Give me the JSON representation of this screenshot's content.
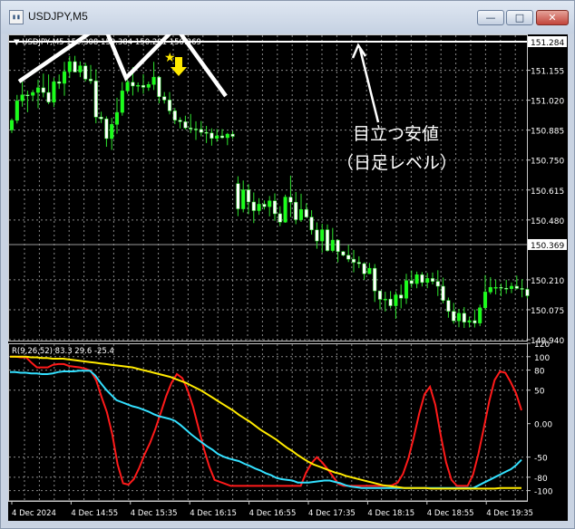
{
  "window": {
    "title": "USDJPY,M5",
    "buttons": {
      "minimize": "—",
      "maximize": "□",
      "close": "✕"
    },
    "icon": "chart-window-icon"
  },
  "chart_data": [
    {
      "type": "candlestick",
      "header": "▼ USDJPY,M5 150.308 150.384 150.291 150.369",
      "price_labels": [
        "151.284",
        "151.155",
        "151.020",
        "150.885",
        "150.750",
        "150.615",
        "150.480",
        "150.369",
        "150.210",
        "150.075",
        "149.940"
      ],
      "ylim": [
        149.94,
        151.284
      ],
      "horizontal_line": {
        "value": 151.284,
        "label": "151.284",
        "color": "#ffffff"
      },
      "current_price": {
        "value": 150.369,
        "label": "150.369"
      },
      "bull_color": "#19ff19",
      "bear_color": "#ffffff",
      "candles": [
        {
          "o": 150.886,
          "h": 150.938,
          "l": 150.872,
          "c": 150.929
        },
        {
          "o": 150.929,
          "h": 151.044,
          "l": 150.915,
          "c": 151.017
        },
        {
          "o": 151.017,
          "h": 151.103,
          "l": 150.991,
          "c": 151.044
        },
        {
          "o": 151.044,
          "h": 151.063,
          "l": 150.966,
          "c": 151.042
        },
        {
          "o": 151.042,
          "h": 151.066,
          "l": 151.016,
          "c": 151.055
        },
        {
          "o": 151.055,
          "h": 151.113,
          "l": 150.984,
          "c": 151.076
        },
        {
          "o": 151.076,
          "h": 151.14,
          "l": 151.033,
          "c": 151.055
        },
        {
          "o": 151.055,
          "h": 151.136,
          "l": 151.002,
          "c": 151.011
        },
        {
          "o": 151.011,
          "h": 151.122,
          "l": 150.989,
          "c": 151.103
        },
        {
          "o": 151.103,
          "h": 151.136,
          "l": 151.071,
          "c": 151.096
        },
        {
          "o": 151.096,
          "h": 151.193,
          "l": 151.04,
          "c": 151.149
        },
        {
          "o": 151.149,
          "h": 151.219,
          "l": 151.12,
          "c": 151.194
        },
        {
          "o": 151.194,
          "h": 151.22,
          "l": 151.148,
          "c": 151.147
        },
        {
          "o": 151.147,
          "h": 151.195,
          "l": 151.124,
          "c": 151.175
        },
        {
          "o": 151.175,
          "h": 151.189,
          "l": 151.104,
          "c": 151.115
        },
        {
          "o": 151.115,
          "h": 151.179,
          "l": 151.094,
          "c": 151.107
        },
        {
          "o": 151.107,
          "h": 151.159,
          "l": 150.916,
          "c": 150.944
        },
        {
          "o": 150.944,
          "h": 150.968,
          "l": 150.917,
          "c": 150.936
        },
        {
          "o": 150.936,
          "h": 150.947,
          "l": 150.81,
          "c": 150.847
        },
        {
          "o": 150.847,
          "h": 150.941,
          "l": 150.796,
          "c": 150.911
        },
        {
          "o": 150.911,
          "h": 151.031,
          "l": 150.869,
          "c": 150.965
        },
        {
          "o": 150.965,
          "h": 151.102,
          "l": 150.95,
          "c": 151.062
        },
        {
          "o": 151.062,
          "h": 151.115,
          "l": 151.049,
          "c": 151.101
        },
        {
          "o": 151.101,
          "h": 151.169,
          "l": 151.041,
          "c": 151.084
        },
        {
          "o": 151.084,
          "h": 151.1,
          "l": 151.057,
          "c": 151.087
        },
        {
          "o": 151.087,
          "h": 151.137,
          "l": 151.049,
          "c": 151.078
        },
        {
          "o": 151.078,
          "h": 151.104,
          "l": 151.062,
          "c": 151.091
        },
        {
          "o": 151.091,
          "h": 151.193,
          "l": 151.066,
          "c": 151.124
        },
        {
          "o": 151.124,
          "h": 151.13,
          "l": 151.006,
          "c": 151.036
        },
        {
          "o": 151.036,
          "h": 151.057,
          "l": 151.005,
          "c": 151.021
        },
        {
          "o": 151.021,
          "h": 151.057,
          "l": 150.956,
          "c": 150.972
        },
        {
          "o": 150.972,
          "h": 150.985,
          "l": 150.912,
          "c": 150.93
        },
        {
          "o": 150.93,
          "h": 150.943,
          "l": 150.893,
          "c": 150.923
        },
        {
          "o": 150.923,
          "h": 150.95,
          "l": 150.888,
          "c": 150.895
        },
        {
          "o": 150.895,
          "h": 150.958,
          "l": 150.872,
          "c": 150.89
        },
        {
          "o": 150.89,
          "h": 150.925,
          "l": 150.841,
          "c": 150.889
        },
        {
          "o": 150.889,
          "h": 150.926,
          "l": 150.857,
          "c": 150.875
        },
        {
          "o": 150.875,
          "h": 150.904,
          "l": 150.827,
          "c": 150.872
        },
        {
          "o": 150.872,
          "h": 150.893,
          "l": 150.815,
          "c": 150.848
        },
        {
          "o": 150.848,
          "h": 150.89,
          "l": 150.833,
          "c": 150.859
        },
        {
          "o": 150.859,
          "h": 150.89,
          "l": 150.846,
          "c": 150.851
        },
        {
          "o": 150.851,
          "h": 150.873,
          "l": 150.817,
          "c": 150.867
        },
        {
          "o": 150.867,
          "h": 150.88,
          "l": 150.846,
          "c": 150.857
        },
        {
          "o": 150.644,
          "h": 150.677,
          "l": 150.497,
          "c": 150.53
        },
        {
          "o": 150.53,
          "h": 150.658,
          "l": 150.514,
          "c": 150.616
        },
        {
          "o": 150.616,
          "h": 150.641,
          "l": 150.506,
          "c": 150.561
        },
        {
          "o": 150.561,
          "h": 150.604,
          "l": 150.466,
          "c": 150.522
        },
        {
          "o": 150.522,
          "h": 150.578,
          "l": 150.503,
          "c": 150.551
        },
        {
          "o": 150.551,
          "h": 150.568,
          "l": 150.527,
          "c": 150.54
        },
        {
          "o": 150.54,
          "h": 150.588,
          "l": 150.496,
          "c": 150.566
        },
        {
          "o": 150.566,
          "h": 150.6,
          "l": 150.476,
          "c": 150.508
        },
        {
          "o": 150.508,
          "h": 150.542,
          "l": 150.452,
          "c": 150.47
        },
        {
          "o": 150.47,
          "h": 150.594,
          "l": 150.467,
          "c": 150.583
        },
        {
          "o": 150.583,
          "h": 150.68,
          "l": 150.493,
          "c": 150.56
        },
        {
          "o": 150.56,
          "h": 150.606,
          "l": 150.461,
          "c": 150.481
        },
        {
          "o": 150.481,
          "h": 150.598,
          "l": 150.471,
          "c": 150.527
        },
        {
          "o": 150.527,
          "h": 150.555,
          "l": 150.492,
          "c": 150.493
        },
        {
          "o": 150.493,
          "h": 150.524,
          "l": 150.414,
          "c": 150.435
        },
        {
          "o": 150.435,
          "h": 150.469,
          "l": 150.35,
          "c": 150.385
        },
        {
          "o": 150.385,
          "h": 150.463,
          "l": 150.333,
          "c": 150.436
        },
        {
          "o": 150.436,
          "h": 150.46,
          "l": 150.337,
          "c": 150.342
        },
        {
          "o": 150.342,
          "h": 150.444,
          "l": 150.334,
          "c": 150.389
        },
        {
          "o": 150.389,
          "h": 150.393,
          "l": 150.289,
          "c": 150.337
        },
        {
          "o": 150.337,
          "h": 150.34,
          "l": 150.316,
          "c": 150.321
        },
        {
          "o": 150.321,
          "h": 150.367,
          "l": 150.29,
          "c": 150.303
        },
        {
          "o": 150.303,
          "h": 150.345,
          "l": 150.244,
          "c": 150.289
        },
        {
          "o": 150.289,
          "h": 150.316,
          "l": 150.263,
          "c": 150.283
        },
        {
          "o": 150.283,
          "h": 150.289,
          "l": 150.21,
          "c": 150.237
        },
        {
          "o": 150.237,
          "h": 150.286,
          "l": 150.236,
          "c": 150.262
        },
        {
          "o": 150.262,
          "h": 150.281,
          "l": 150.11,
          "c": 150.16
        },
        {
          "o": 150.16,
          "h": 150.159,
          "l": 150.076,
          "c": 150.122
        },
        {
          "o": 150.122,
          "h": 150.156,
          "l": 150.067,
          "c": 150.123
        },
        {
          "o": 150.123,
          "h": 150.159,
          "l": 150.081,
          "c": 150.093
        },
        {
          "o": 150.093,
          "h": 150.158,
          "l": 150.034,
          "c": 150.142
        },
        {
          "o": 150.142,
          "h": 150.189,
          "l": 150.081,
          "c": 150.127
        },
        {
          "o": 150.127,
          "h": 150.237,
          "l": 150.101,
          "c": 150.206
        },
        {
          "o": 150.206,
          "h": 150.252,
          "l": 150.174,
          "c": 150.193
        },
        {
          "o": 150.193,
          "h": 150.247,
          "l": 150.172,
          "c": 150.233
        },
        {
          "o": 150.233,
          "h": 150.245,
          "l": 150.18,
          "c": 150.198
        },
        {
          "o": 150.198,
          "h": 150.241,
          "l": 150.172,
          "c": 150.216
        },
        {
          "o": 150.216,
          "h": 150.243,
          "l": 150.189,
          "c": 150.203
        },
        {
          "o": 150.203,
          "h": 150.253,
          "l": 150.137,
          "c": 150.181
        },
        {
          "o": 150.181,
          "h": 150.22,
          "l": 150.104,
          "c": 150.117
        },
        {
          "o": 150.117,
          "h": 150.13,
          "l": 150.039,
          "c": 150.068
        },
        {
          "o": 150.068,
          "h": 150.106,
          "l": 150.012,
          "c": 150.025
        },
        {
          "o": 150.025,
          "h": 150.079,
          "l": 149.996,
          "c": 150.059
        },
        {
          "o": 150.059,
          "h": 150.087,
          "l": 149.993,
          "c": 150.019
        },
        {
          "o": 150.019,
          "h": 150.044,
          "l": 149.995,
          "c": 150.026
        },
        {
          "o": 150.026,
          "h": 150.076,
          "l": 149.995,
          "c": 150.015
        },
        {
          "o": 150.015,
          "h": 150.098,
          "l": 150.001,
          "c": 150.084
        },
        {
          "o": 150.084,
          "h": 150.231,
          "l": 150.074,
          "c": 150.155
        },
        {
          "o": 150.155,
          "h": 150.222,
          "l": 150.145,
          "c": 150.176
        },
        {
          "o": 150.176,
          "h": 150.211,
          "l": 150.144,
          "c": 150.176
        },
        {
          "o": 150.176,
          "h": 150.193,
          "l": 150.136,
          "c": 150.172
        },
        {
          "o": 150.172,
          "h": 150.21,
          "l": 150.147,
          "c": 150.17
        },
        {
          "o": 150.17,
          "h": 150.198,
          "l": 150.15,
          "c": 150.181
        },
        {
          "o": 150.181,
          "h": 150.229,
          "l": 150.166,
          "c": 150.171
        },
        {
          "o": 150.171,
          "h": 150.213,
          "l": 150.131,
          "c": 150.167
        },
        {
          "o": 150.167,
          "h": 150.174,
          "l": 150.126,
          "c": 150.138
        }
      ],
      "annotation": {
        "line1": "目立つ安値",
        "line2": "（日足レベル）",
        "color": "#ffffff"
      },
      "markers": [
        "star-marker",
        "down-arrow-marker"
      ],
      "marker_color": "#ffea00"
    },
    {
      "type": "line",
      "header": "R(9,26,52) 83.3 29.6 -25.4",
      "ylabels": [
        "120",
        "100",
        "80",
        "50",
        "0.00",
        "-50",
        "-80",
        "-100"
      ],
      "ylim": [
        -110,
        120
      ],
      "ref_lines": [
        100,
        80,
        50,
        -50,
        -80,
        -100
      ],
      "series": [
        {
          "color": "#ff1a1a",
          "values": [
            100,
            100,
            99,
            99,
            91,
            84,
            84,
            84,
            88,
            89,
            89,
            86,
            85,
            84,
            82,
            79,
            65,
            40,
            17,
            -16,
            -61,
            -89,
            -91,
            -83,
            -66,
            -46,
            -29,
            -8,
            16,
            41,
            61,
            74,
            68,
            50,
            25,
            -6,
            -37,
            -64,
            -84,
            -87,
            -90,
            -93,
            -93,
            -93,
            -93,
            -93,
            -93,
            -93,
            -93,
            -93,
            -93,
            -93,
            -93,
            -93,
            -93,
            -73,
            -59,
            -50,
            -58,
            -68,
            -79,
            -90,
            -93,
            -93,
            -93,
            -93,
            -93,
            -93,
            -93,
            -93,
            -93,
            -92,
            -88,
            -75,
            -52,
            -20,
            15,
            44,
            55,
            28,
            -17,
            -58,
            -84,
            -93,
            -93,
            -93,
            -76,
            -45,
            -7,
            33,
            65,
            78,
            76,
            62,
            45,
            20
          ]
        },
        {
          "color": "#33e0ff",
          "values": [
            77,
            77,
            76,
            76,
            75,
            75,
            74,
            74,
            75,
            77,
            78,
            78,
            78,
            79,
            79,
            79,
            72,
            61,
            51,
            43,
            35,
            32,
            29,
            26,
            24,
            21,
            18,
            14,
            11,
            9,
            7,
            4,
            -2,
            -9,
            -16,
            -22,
            -28,
            -34,
            -39,
            -45,
            -49,
            -52,
            -54,
            -56,
            -60,
            -63,
            -67,
            -70,
            -74,
            -77,
            -81,
            -83,
            -84,
            -85,
            -88,
            -88,
            -88,
            -87,
            -86,
            -85,
            -85,
            -87,
            -89,
            -92,
            -94,
            -95,
            -96,
            -96,
            -96,
            -96,
            -96,
            -96,
            -96,
            -96,
            -96,
            -96,
            -96,
            -96,
            -96,
            -96,
            -96,
            -96,
            -96,
            -96,
            -96,
            -96,
            -96,
            -96,
            -92,
            -88,
            -84,
            -80,
            -76,
            -72,
            -68,
            -62,
            -54
          ]
        },
        {
          "color": "#ffea00",
          "values": [
            100,
            100,
            100,
            100,
            99,
            99,
            98,
            98,
            97,
            97,
            97,
            96,
            95,
            94,
            93,
            92,
            91,
            90,
            89,
            88,
            87,
            86,
            85,
            84,
            82,
            80,
            78,
            76,
            74,
            72,
            70,
            67,
            64,
            61,
            57,
            53,
            49,
            44,
            39,
            34,
            29,
            24,
            19,
            13,
            8,
            3,
            -3,
            -9,
            -14,
            -19,
            -24,
            -30,
            -36,
            -41,
            -47,
            -52,
            -57,
            -61,
            -64,
            -67,
            -70,
            -73,
            -75,
            -78,
            -80,
            -82,
            -84,
            -86,
            -88,
            -90,
            -92,
            -93,
            -94,
            -95,
            -96,
            -96,
            -96,
            -96,
            -96,
            -97,
            -97,
            -97,
            -97,
            -97,
            -97,
            -97,
            -97,
            -97,
            -97,
            -97,
            -97,
            -97,
            -96,
            -96,
            -96,
            -96,
            -96
          ]
        }
      ]
    }
  ],
  "time_axis": [
    "4 Dec 2024",
    "4 Dec 14:55",
    "4 Dec 15:35",
    "4 Dec 16:15",
    "4 Dec 16:55",
    "4 Dec 17:35",
    "4 Dec 18:15",
    "4 Dec 18:55",
    "4 Dec 19:35"
  ]
}
